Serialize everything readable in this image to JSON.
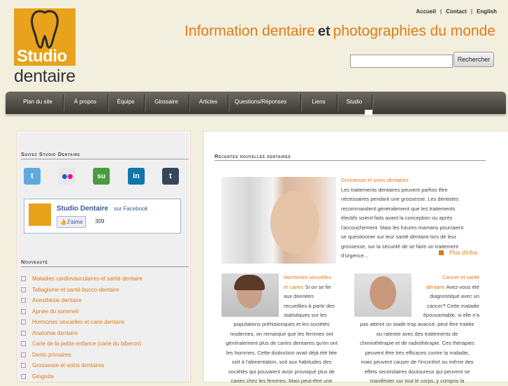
{
  "logo": {
    "line1": "Studio",
    "line2": "dentaire"
  },
  "toplinks": [
    "Accueil",
    "Contact",
    "English"
  ],
  "tagline": {
    "part1": "Information dentaire",
    "et": "et",
    "part2": "photographies du monde"
  },
  "search": {
    "value": "",
    "button": "Rechercher"
  },
  "nav": [
    "Plan du site",
    "À propos",
    "Équipe",
    "Glossaire",
    "Articles",
    "Questions/Réponses",
    "Liens",
    "Studio"
  ],
  "sidebar": {
    "follow_title": "Suivez Studio Dentaire",
    "social": [
      "twitter-icon",
      "flickr-icon",
      "stumbleupon-icon",
      "linkedin-icon",
      "tumblr-icon"
    ],
    "facebook": {
      "page": "Studio Dentaire",
      "suffix": "sur Facebook",
      "like": "J'aime",
      "count": "309"
    },
    "news_title": "Nouveauté",
    "news": [
      "Maladies cardiovasculaires et santé dentaire",
      "Tabagisme et santé bucco-dentaire",
      "Anesthésie dentaire",
      "Apnée du sommeil",
      "Hormones sexuelles et carie dentaire",
      "Anatomie dentaire",
      "Carie de la petite enfance (carie du biberon)",
      "Dents primaires",
      "Grossesse et soins dentaires",
      "Gingivite"
    ]
  },
  "main": {
    "title": "Récentes nouvelles dentaires",
    "article1": {
      "title": "Grossesse et soins dentaires",
      "lines": [
        "Les traitements dentaires peuvent parfois être",
        "nécessaires pendant une grossesse. Les dentistes",
        "recommandent généralement que les traitements",
        "électifs soient faits avant la conception ou après",
        "l'accouchement. Mais les futures mamans pourraient",
        "se questionner sur leur santé dentaire lors de leur",
        "grossesse, sur la sécurité de se faire un traitement",
        "d'urgence..."
      ],
      "more": "Plus d'infos"
    },
    "article2": {
      "title_l1": "Hormones sexuelles",
      "title_l2": "et caries",
      "side_lines": [
        " Si on se fie",
        "aux données",
        "recueillies à partir des",
        "statistiques sur les"
      ],
      "lines": [
        "populations préhistoriques et les sociétés",
        "modernes, on remarque que les femmes ont",
        "généralement plus de caries dentaires qu'en ont",
        "les hommes. Cette distinction avait déjà été liée",
        "soit à l'alimentation, soit aux habitudes des",
        "sociétés qui pouvaient avoir provoqué plus de",
        "caries chez les femmes. Mais peut-être une"
      ]
    },
    "article3": {
      "title_l1": "Cancer et santé",
      "title_l2": "dentaire",
      "side_lines": [
        " Avez-vous été",
        "diagnostiqué avec un",
        "cancer? Cette maladie",
        "épouvantable, si elle n'a"
      ],
      "lines": [
        "pas atteint un stade trop avancé, peut être traitée",
        "ou ralentie avec des traitements de",
        "chimiothérapie et de radiothérapie. Ces thérapies",
        "peuvent être très efficaces contre la maladie,",
        "mais peuvent causer de l'inconfort ou même des",
        "effets secondaires douloureux qui peuvent se",
        "manifester sur tout le corps, y compris la"
      ]
    }
  },
  "colors": {
    "accent": "#e07b12",
    "logo": "#e8a21b",
    "nav": "#3a3833",
    "background": "#f3efdf"
  }
}
